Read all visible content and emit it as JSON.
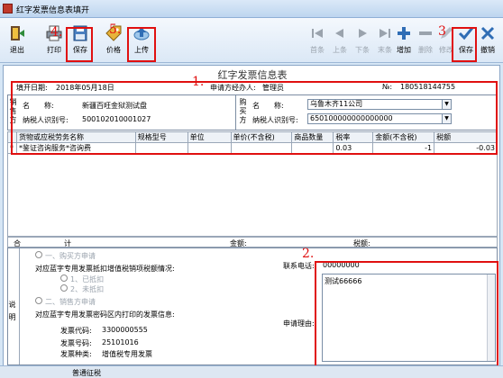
{
  "window": {
    "title": "红字发票信息表填开"
  },
  "toolbar": {
    "exit": "退出",
    "print": "打印",
    "save_left": "保存",
    "price": "价格",
    "upload": "上传",
    "first": "首条",
    "prev": "上条",
    "next": "下条",
    "last": "末条",
    "add": "增加",
    "delete": "删除",
    "modify": "修改",
    "save_right": "保存",
    "cancel": "撤销"
  },
  "annotations": {
    "n1": "1.",
    "n2": "2.",
    "n3": "3",
    "n4": "4.",
    "n5": "5."
  },
  "form": {
    "title": "红字发票信息表",
    "fill_date_label": "填开日期:",
    "fill_date": "2018年05月18日",
    "agent_label": "申请方经办人:",
    "agent": "管理员",
    "no_label": "№:",
    "no": "180518144755"
  },
  "seller": {
    "side_label": "销售方",
    "name_label": "名　　称:",
    "name": "新疆百旺金狱测试盘",
    "tax_label": "纳税人识别号:",
    "tax_id": "500102010001027"
  },
  "buyer": {
    "side_label": "购买方",
    "name_label": "名　　称:",
    "name": "乌鲁木齐11公司",
    "tax_label": "纳税人识别号:",
    "tax_id": "650100000000000000"
  },
  "items_table": {
    "headers": [
      "货物或应税劳务名称",
      "规格型号",
      "单位",
      "单价(不含税)",
      "商品数量",
      "税率",
      "金额(不含税)",
      "税额"
    ],
    "rows": [
      {
        "marker": "*",
        "name": "*鉴证咨询服务*咨询费",
        "spec": "",
        "unit": "",
        "price": "",
        "qty": "",
        "rate": "0.03",
        "amount": "-1",
        "tax": "-0.03"
      }
    ]
  },
  "totals": {
    "he": "合",
    "ji": "计",
    "amount_label": "金额:",
    "tax_label": "税额:"
  },
  "explanation": {
    "side_label": "说明",
    "opt1": "一、购买方申请",
    "opt1_q": "对应蓝字专用发票抵扣增值税销项税额情况:",
    "opt1_a": "1、已抵扣",
    "opt1_b": "2、未抵扣",
    "opt2": "二、销售方申请",
    "opt2_q": "对应蓝字专用发票密码区内打印的发票信息:",
    "code_label": "发票代码:",
    "code": "3300000555",
    "num_label": "发票号码:",
    "num": "25101016",
    "kind_label": "发票种类:",
    "kind": "增值税专用发票"
  },
  "contact": {
    "phone_label": "联系电话:",
    "phone": "00000000"
  },
  "reason": {
    "label": "申请理由:",
    "text": "测试66666"
  },
  "status": {
    "text": "普通征税"
  }
}
